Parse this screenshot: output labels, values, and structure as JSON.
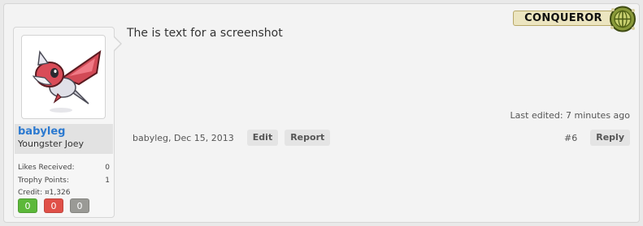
{
  "post": {
    "message": "The is text for a screenshot",
    "last_edited": "Last edited: 7 minutes ago",
    "author_meta": "babyleg, Dec 15, 2013",
    "buttons": {
      "edit": "Edit",
      "report": "Report",
      "reply": "Reply"
    },
    "post_number": "#6"
  },
  "user": {
    "name": "babyleg",
    "title": "Youngster Joey",
    "stats": {
      "likes_label": "Likes Received:",
      "likes_value": "0",
      "trophy_label": "Trophy Points:",
      "trophy_value": "1",
      "credit": "Credit: ¤1,326"
    },
    "badges": [
      {
        "value": "0",
        "color": "#5cb83a"
      },
      {
        "value": "0",
        "color": "#e05048"
      },
      {
        "value": "0",
        "color": "#9a9a96"
      }
    ],
    "avatar_icon": "latias-sprite-icon"
  },
  "logo": {
    "text": "CONQUEROR",
    "icon": "globe-emblem-icon"
  }
}
